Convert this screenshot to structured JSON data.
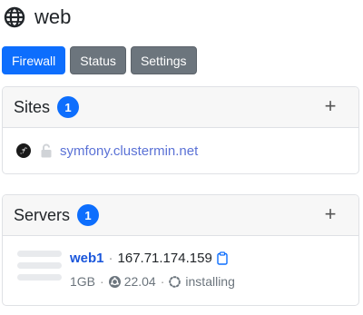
{
  "header": {
    "title": "web",
    "icon": "globe-icon"
  },
  "tabs": [
    {
      "label": "Firewall",
      "active": true
    },
    {
      "label": "Status",
      "active": false
    },
    {
      "label": "Settings",
      "active": false
    }
  ],
  "sites": {
    "title": "Sites",
    "count": "1",
    "add_label": "+",
    "items": [
      {
        "framework_icon": "symfony-icon",
        "ssl_icon": "unlock-icon",
        "domain": "symfony.clustermin.net"
      }
    ]
  },
  "servers": {
    "title": "Servers",
    "count": "1",
    "add_label": "+",
    "items": [
      {
        "name": "web1",
        "separator": "·",
        "ip": "167.71.174.159",
        "memory": "1GB",
        "os_icon": "ubuntu-icon",
        "os_version": "22.04",
        "status": "installing"
      }
    ]
  },
  "colors": {
    "primary": "#0d6efd",
    "secondary": "#6c757d",
    "link": "#5b72d6",
    "server_link": "#1a56db"
  }
}
